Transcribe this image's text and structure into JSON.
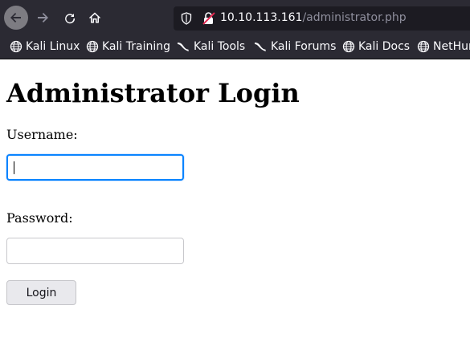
{
  "browser": {
    "url_host": "10.10.113.161",
    "url_path": "/administrator.php",
    "nav_icons": [
      "back-arrow-icon",
      "forward-arrow-icon",
      "reload-icon",
      "home-icon"
    ],
    "bookmarks": [
      {
        "label": "Kali Linux",
        "icon": "globe-icon"
      },
      {
        "label": "Kali Training",
        "icon": "globe-icon"
      },
      {
        "label": "Kali Tools",
        "icon": "kali-dragon-icon"
      },
      {
        "label": "Kali Forums",
        "icon": "kali-dragon-icon"
      },
      {
        "label": "Kali Docs",
        "icon": "globe-icon"
      },
      {
        "label": "NetHunter",
        "icon": "globe-icon"
      }
    ],
    "colors": {
      "chrome": "#2b2a33",
      "urlbar": "#1c1b22",
      "focus": "#0a84ff"
    }
  },
  "page": {
    "title": "Administrator Login",
    "username_label": "Username:",
    "username_value": "",
    "password_label": "Password:",
    "password_value": "",
    "login_label": "Login"
  }
}
